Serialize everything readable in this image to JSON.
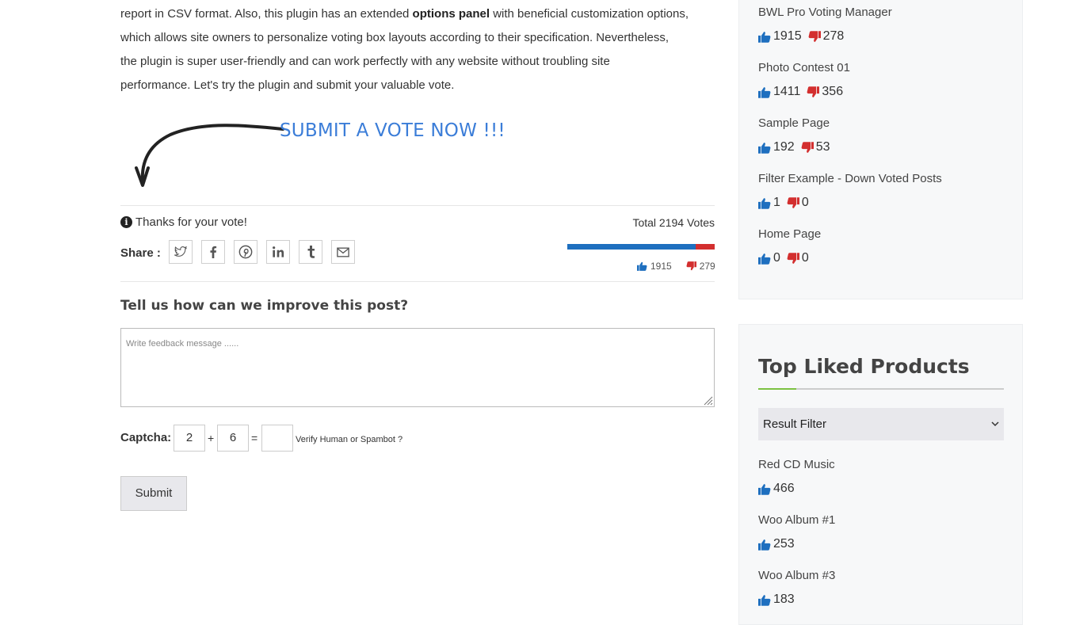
{
  "intro": {
    "line1_pre": "report in CSV format. Also, this plugin has an extended ",
    "line1_bold": "options panel",
    "line1_post": " with beneficial customization options,",
    "line2": "which allows site owners to personalize voting box layouts according to their specification. Nevertheless,",
    "line3": "the plugin is super user-friendly and can work perfectly with any website without troubling site",
    "line4": "performance. Let's try the plugin and submit your valuable vote."
  },
  "cta": "SUBMIT A VOTE NOW !!!",
  "vote_box": {
    "thanks": "Thanks for your vote!",
    "total": "Total 2194 Votes",
    "share_label": "Share :",
    "up_count": "1915",
    "down_count": "279",
    "up_fraction": 0.873,
    "share_icons": [
      "twitter-icon",
      "facebook-icon",
      "pinterest-icon",
      "linkedin-icon",
      "tumblr-icon",
      "email-icon"
    ]
  },
  "feedback": {
    "question": "Tell us how can we improve this post?",
    "placeholder": "Write feedback message ......",
    "captcha_label": "Captcha:",
    "num1": "2",
    "plus": "+",
    "num2": "6",
    "equals": "=",
    "answer": "",
    "verify_text": "Verify Human or Spambot ?",
    "submit_label": "Submit"
  },
  "sidebar_votes": {
    "items": [
      {
        "title": "BWL Pro Voting Manager",
        "up": "1915",
        "down": "278"
      },
      {
        "title": "Photo Contest 01",
        "up": "1411",
        "down": "356"
      },
      {
        "title": "Sample Page",
        "up": "192",
        "down": "53"
      },
      {
        "title": "Filter Example - Down Voted Posts",
        "up": "1",
        "down": "0"
      },
      {
        "title": "Home Page",
        "up": "0",
        "down": "0"
      }
    ]
  },
  "top_liked": {
    "title": "Top Liked Products",
    "filter_selected": "Result Filter",
    "items": [
      {
        "title": "Red CD Music",
        "up": "466"
      },
      {
        "title": "Woo Album #1",
        "up": "253"
      },
      {
        "title": "Woo Album #3",
        "up": "183"
      }
    ]
  },
  "colors": {
    "thumb_up": "#1e6fbf",
    "thumb_down": "#d32f2f",
    "cta_blue": "#3b7dd8",
    "accent_green": "#7cc142"
  }
}
